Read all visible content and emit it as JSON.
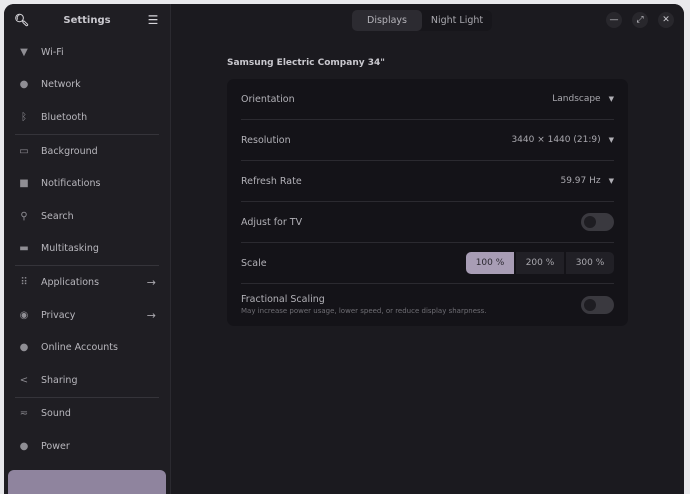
{
  "sidebar": {
    "title": "Settings",
    "search_icon": "search-icon",
    "menu_icon": "hamburger-menu-icon",
    "items": [
      {
        "label": "Wi-Fi",
        "icon": "wifi-icon"
      },
      {
        "label": "Network",
        "icon": "globe-icon"
      },
      {
        "label": "Bluetooth",
        "icon": "bluetooth-icon"
      },
      {
        "label": "Background",
        "icon": "monitor-icon"
      },
      {
        "label": "Notifications",
        "icon": "bell-icon"
      },
      {
        "label": "Search",
        "icon": "search-icon"
      },
      {
        "label": "Multitasking",
        "icon": "windows-icon"
      },
      {
        "label": "Applications",
        "icon": "grid-icon"
      },
      {
        "label": "Privacy",
        "icon": "privacy-icon"
      },
      {
        "label": "Online Accounts",
        "icon": "accounts-icon"
      },
      {
        "label": "Sharing",
        "icon": "share-icon"
      },
      {
        "label": "Sound",
        "icon": "sound-icon"
      },
      {
        "label": "Power",
        "icon": "power-icon"
      }
    ],
    "selected_color": "#8f849e"
  },
  "tabs": [
    {
      "label": "Displays",
      "active": true
    },
    {
      "label": "Night Light",
      "active": false
    }
  ],
  "main": {
    "monitor_title": "Samsung Electric Company 34\"",
    "orientation": {
      "label": "Orientation",
      "value": "Landscape"
    },
    "resolution": {
      "label": "Resolution",
      "value": "3440 × 1440 (21:9)"
    },
    "refresh": {
      "label": "Refresh Rate",
      "value": "59.97 Hz"
    },
    "adjust_tv": {
      "label": "Adjust for TV",
      "on": false
    },
    "scale": {
      "label": "Scale",
      "options": [
        "100 %",
        "200 %",
        "300 %"
      ],
      "selected": "100 %"
    },
    "fractional": {
      "label": "Fractional Scaling",
      "subtitle": "May increase power usage, lower speed, or reduce display sharpness.",
      "on": false
    }
  }
}
